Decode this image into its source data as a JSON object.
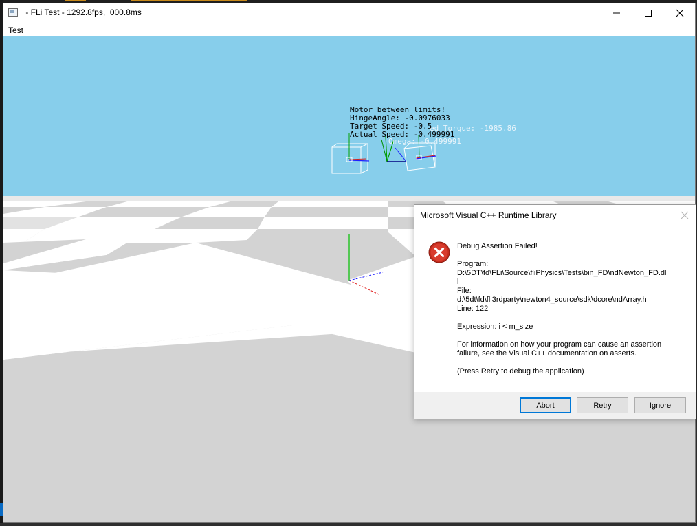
{
  "window": {
    "title": " - FLi Test - 1292.8fps,  000.8ms",
    "app_icon": "app-window-icon",
    "controls": [
      "minimize-icon",
      "maximize-icon",
      "close-icon"
    ]
  },
  "menu": {
    "items": [
      "Test"
    ]
  },
  "hud": {
    "line1": "Motor between limits!",
    "line2": "HingeAngle: -0.0976033",
    "line3": "Target Speed: -0.5",
    "line4": "Actual Speed: -0.499991",
    "ghost1": "ed Torque: -1985.86",
    "ghost2": "Omega: -0.499991"
  },
  "dialog": {
    "title": "Microsoft Visual C++ Runtime Library",
    "icon": "error-icon",
    "heading": "Debug Assertion Failed!",
    "program_label": "Program:",
    "program_path_1": "D:\\5DT\\fd\\FLi\\Source\\fliPhysics\\Tests\\bin_FD\\ndNewton_FD.dl",
    "program_path_2": "l",
    "file_label": "File:",
    "file_path": "d:\\5dt\\fd\\fli3rdparty\\newton4_source\\sdk\\dcore\\ndArray.h",
    "line": "Line: 122",
    "expression": "Expression: i < m_size",
    "info_1": "For information on how your program can cause an assertion",
    "info_2": "failure, see the Visual C++ documentation on asserts.",
    "press_retry": "(Press Retry to debug the application)",
    "buttons": {
      "abort": "Abort",
      "retry": "Retry",
      "ignore": "Ignore"
    }
  },
  "colors": {
    "sky": "#87ceeb",
    "floor_light": "#ffffff",
    "floor_dark": "#d3d3d3",
    "dialog_default_border": "#0078d7",
    "error_red": "#c42b1c"
  }
}
